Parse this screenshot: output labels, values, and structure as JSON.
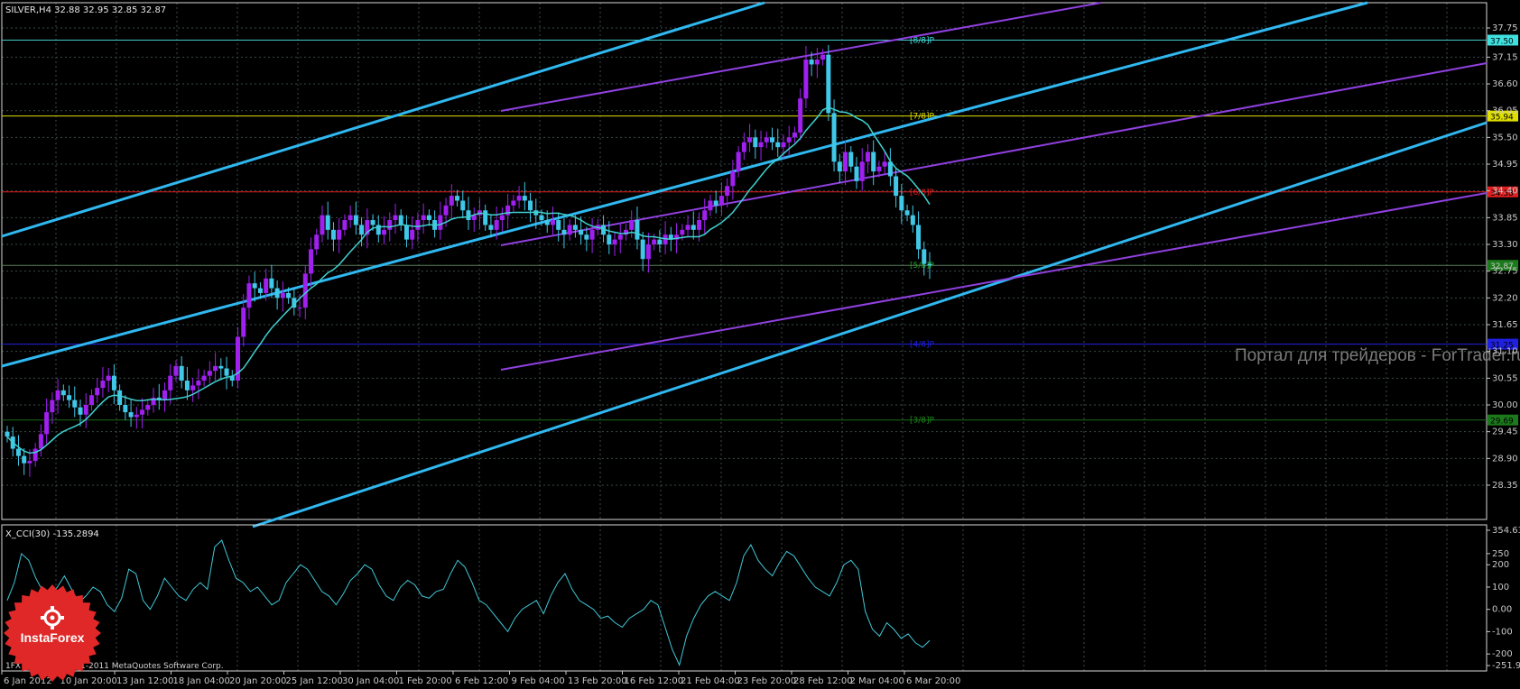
{
  "header": {
    "symbol_line": "SILVER,H4  32.88 32.95 32.85 32.87"
  },
  "price_axis": {
    "ticks": [
      "37.75",
      "37.15",
      "36.60",
      "36.05",
      "35.50",
      "34.95",
      "34.40",
      "33.85",
      "33.30",
      "32.75",
      "32.20",
      "31.65",
      "31.10",
      "30.55",
      "30.00",
      "29.45",
      "28.90",
      "28.35"
    ]
  },
  "levels": [
    {
      "value": 37.5,
      "label": "[8/8]P",
      "tag": "37.50",
      "line_color": "#40c8c8",
      "tag_bg": "#40e0e0",
      "tag_fg": "#000000",
      "label_color": "#40e0e0"
    },
    {
      "value": 35.94,
      "label": "[7/8]P",
      "tag": "35.94",
      "line_color": "#e0e000",
      "tag_bg": "#e0e000",
      "tag_fg": "#000000",
      "label_color": "#e0e000"
    },
    {
      "value": 34.38,
      "label": "[6/8]P",
      "tag": "34.38",
      "line_color": "#e02020",
      "tag_bg": "#e02020",
      "tag_fg": "#000000",
      "label_color": "#e02020"
    },
    {
      "value": 32.87,
      "label": "[5/8]P",
      "tag": "32.87",
      "line_color": "#5a7a5a",
      "tag_bg": "#1c7a1c",
      "tag_fg": "#c8c8c8",
      "label_color": "#20a020"
    },
    {
      "value": 31.25,
      "label": "[4/8]P",
      "tag": "31.25",
      "line_color": "#2020e0",
      "tag_bg": "#2020e0",
      "tag_fg": "#000000",
      "label_color": "#2020e0"
    },
    {
      "value": 29.69,
      "label": "[3/8]P",
      "tag": "29.69",
      "line_color": "#1c6a1c",
      "tag_bg": "#1c7a1c",
      "tag_fg": "#000000",
      "label_color": "#1c8a1c"
    }
  ],
  "time_axis": {
    "ticks": [
      "6 Jan 2012",
      "10 Jan 20:00",
      "13 Jan 12:00",
      "18 Jan 04:00",
      "20 Jan 20:00",
      "25 Jan 12:00",
      "30 Jan 04:00",
      "1 Feb 20:00",
      "6 Feb 12:00",
      "9 Feb 04:00",
      "13 Feb 20:00",
      "16 Feb 12:00",
      "21 Feb 04:00",
      "23 Feb 20:00",
      "28 Feb 12:00",
      "2 Mar 04:00",
      "6 Mar 20:00"
    ]
  },
  "indicator": {
    "title": "X_CCI(30) -135.2894",
    "ticks": [
      "354.631",
      "250",
      "200",
      "100",
      "0.00",
      "-100",
      "-200",
      "-251.967"
    ]
  },
  "watermark": "Портал для трейдеров - ForTrader.ru",
  "copyright": "1FX Trader, © 2001-2011 MetaQuotes Software Corp.",
  "logo": {
    "text": "InstaForex"
  },
  "colors": {
    "background": "#000000",
    "grid": "#3a4a4a",
    "bull_candle": "#a020f0",
    "bear_candle": "#40c8e8",
    "ma": "#40d0d0",
    "channel_blue": "#30b8f0",
    "channel_purple": "#9040e0",
    "cci": "#40c8d8",
    "logo": "#e02828"
  },
  "chart_data": {
    "type": "candlestick",
    "symbol": "SILVER",
    "timeframe": "H4",
    "ohlc_last": {
      "open": 32.88,
      "high": 32.95,
      "low": 32.85,
      "close": 32.87
    },
    "ylim": [
      28.35,
      37.75
    ],
    "closes": [
      29.35,
      29.1,
      28.95,
      28.8,
      28.85,
      29.1,
      29.4,
      29.85,
      30.1,
      30.3,
      30.2,
      30.1,
      29.95,
      29.8,
      30.0,
      30.2,
      30.35,
      30.5,
      30.6,
      30.3,
      30.0,
      29.85,
      29.75,
      29.8,
      29.9,
      30.0,
      30.15,
      30.1,
      30.3,
      30.6,
      30.8,
      30.5,
      30.3,
      30.4,
      30.5,
      30.6,
      30.7,
      30.8,
      30.75,
      30.6,
      30.5,
      31.4,
      32.0,
      32.5,
      32.4,
      32.3,
      32.6,
      32.4,
      32.2,
      32.3,
      32.2,
      32.0,
      32.0,
      32.7,
      33.2,
      33.5,
      33.9,
      33.6,
      33.4,
      33.6,
      33.8,
      33.9,
      33.7,
      33.5,
      33.8,
      33.7,
      33.5,
      33.6,
      33.8,
      33.9,
      33.7,
      33.4,
      33.6,
      33.8,
      33.9,
      33.8,
      33.6,
      33.9,
      34.1,
      34.3,
      34.2,
      34.0,
      33.8,
      33.9,
      34.0,
      33.7,
      33.6,
      33.8,
      33.9,
      34.1,
      34.2,
      34.3,
      34.2,
      34.0,
      33.9,
      33.8,
      33.7,
      33.8,
      33.6,
      33.5,
      33.7,
      33.6,
      33.5,
      33.4,
      33.6,
      33.7,
      33.5,
      33.3,
      33.4,
      33.5,
      33.6,
      33.8,
      33.4,
      33.0,
      33.3,
      33.4,
      33.3,
      33.5,
      33.4,
      33.5,
      33.6,
      33.7,
      33.6,
      33.8,
      34.0,
      34.2,
      34.1,
      34.3,
      34.5,
      34.8,
      35.2,
      35.4,
      35.5,
      35.3,
      35.4,
      35.5,
      35.4,
      35.3,
      35.4,
      35.5,
      35.6,
      36.3,
      37.1,
      37.0,
      37.1,
      37.2,
      36.0,
      35.0,
      34.8,
      35.2,
      34.9,
      34.6,
      35.0,
      35.2,
      34.8,
      34.9,
      35.0,
      34.7,
      34.3,
      34.0,
      33.9,
      33.7,
      33.2,
      32.9,
      32.87
    ],
    "cci": {
      "name": "X_CCI(30)",
      "last": -135.2894,
      "ylim": [
        -251.967,
        354.631
      ],
      "values": [
        40,
        120,
        250,
        220,
        140,
        80,
        60,
        100,
        150,
        90,
        30,
        60,
        100,
        80,
        20,
        -10,
        50,
        180,
        160,
        40,
        0,
        60,
        140,
        100,
        60,
        40,
        90,
        120,
        90,
        280,
        310,
        220,
        140,
        120,
        80,
        100,
        60,
        20,
        40,
        120,
        160,
        200,
        180,
        130,
        80,
        60,
        20,
        70,
        130,
        160,
        200,
        180,
        110,
        60,
        40,
        100,
        130,
        110,
        60,
        50,
        80,
        90,
        160,
        220,
        190,
        120,
        40,
        20,
        -20,
        -60,
        -100,
        -40,
        0,
        20,
        40,
        -20,
        60,
        120,
        160,
        90,
        40,
        20,
        0,
        -40,
        -30,
        -60,
        -80,
        -40,
        -20,
        0,
        40,
        20,
        -80,
        -180,
        -250,
        -120,
        -40,
        20,
        60,
        80,
        60,
        40,
        120,
        240,
        290,
        220,
        180,
        150,
        210,
        260,
        240,
        190,
        140,
        100,
        80,
        60,
        120,
        200,
        220,
        180,
        -10,
        -90,
        -120,
        -60,
        -90,
        -130,
        -110,
        -150,
        -170,
        -140
      ]
    }
  }
}
